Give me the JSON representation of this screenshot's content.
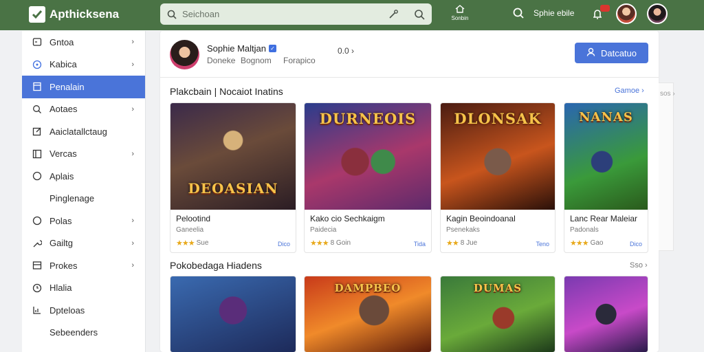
{
  "app": {
    "title": "Apthicksena"
  },
  "search": {
    "placeholder": "Seichoan"
  },
  "topbar": {
    "home_label": "Sonbin",
    "user_label": "Sphie ebile"
  },
  "sidebar": {
    "items": [
      {
        "label": "Gntoa",
        "icon": "gamepad-icon",
        "chevron": true,
        "active": false
      },
      {
        "label": "Kabica",
        "icon": "compass-icon",
        "chevron": true,
        "active": false
      },
      {
        "label": "Penalain",
        "icon": "book-icon",
        "chevron": false,
        "active": true
      },
      {
        "label": "Aotaes",
        "icon": "search-icon",
        "chevron": true,
        "active": false
      },
      {
        "label": "Aaiclatallctaug",
        "icon": "edit-icon",
        "chevron": false,
        "active": false
      },
      {
        "label": "Vercas",
        "icon": "list-icon",
        "chevron": true,
        "active": false
      },
      {
        "label": "Aplais",
        "icon": "circle-icon",
        "chevron": false,
        "active": false
      },
      {
        "label": "Pinglenage",
        "icon": "blank-icon",
        "chevron": false,
        "active": false
      },
      {
        "label": "Polas",
        "icon": "circle-icon",
        "chevron": true,
        "active": false
      },
      {
        "label": "Gailtg",
        "icon": "wrench-icon",
        "chevron": true,
        "active": false
      },
      {
        "label": "Prokes",
        "icon": "image-icon",
        "chevron": true,
        "active": false
      },
      {
        "label": "Hlalia",
        "icon": "clock-icon",
        "chevron": false,
        "active": false
      },
      {
        "label": "Dpteloas",
        "icon": "chart-icon",
        "chevron": false,
        "active": false
      },
      {
        "label": "Sebeenders",
        "icon": "blank-icon",
        "chevron": false,
        "active": false
      }
    ]
  },
  "profile": {
    "name": "Sophie Maltjan",
    "meta": [
      "Doneke",
      "Bognom",
      "Forapico"
    ],
    "count": "0.0",
    "button_label": "Datcatuo"
  },
  "sections": [
    {
      "title": "Plakcbain | Nocaiot Inatins",
      "link": "Gamoe",
      "cards": [
        {
          "art_title": "DEOASIAN",
          "title": "Pelootind",
          "sub": "Ganeelia",
          "rating": "Sue",
          "price": "Dico",
          "stars": "★★★"
        },
        {
          "art_title": "DURNEOIS",
          "title": "Kako cio Sechkaigm",
          "sub": "Paidecia",
          "rating": "8  Goin",
          "price": "Tida",
          "stars": "★★★"
        },
        {
          "art_title": "DLONSAK",
          "title": "Kagin Beoindoanal",
          "sub": "Psenekaks",
          "rating": "8  Jue",
          "price": "Teno",
          "stars": "★★"
        },
        {
          "art_title": "NANAS",
          "title": "Lanc Rear Maleiar",
          "sub": "Padonals",
          "rating": "Gao",
          "price": "Dico",
          "stars": "★★★"
        }
      ]
    },
    {
      "title": "Pokobedaga Hiadens",
      "link": "Sso",
      "cards": [
        {
          "art_title": ""
        },
        {
          "art_title": "DAMPBEO"
        },
        {
          "art_title": "DUMAS"
        },
        {
          "art_title": ""
        }
      ]
    }
  ],
  "side_panel": {
    "link": "sos"
  },
  "colors": {
    "topbar": "#4a7345",
    "accent": "#4a74d9",
    "star": "#e8a91a"
  }
}
